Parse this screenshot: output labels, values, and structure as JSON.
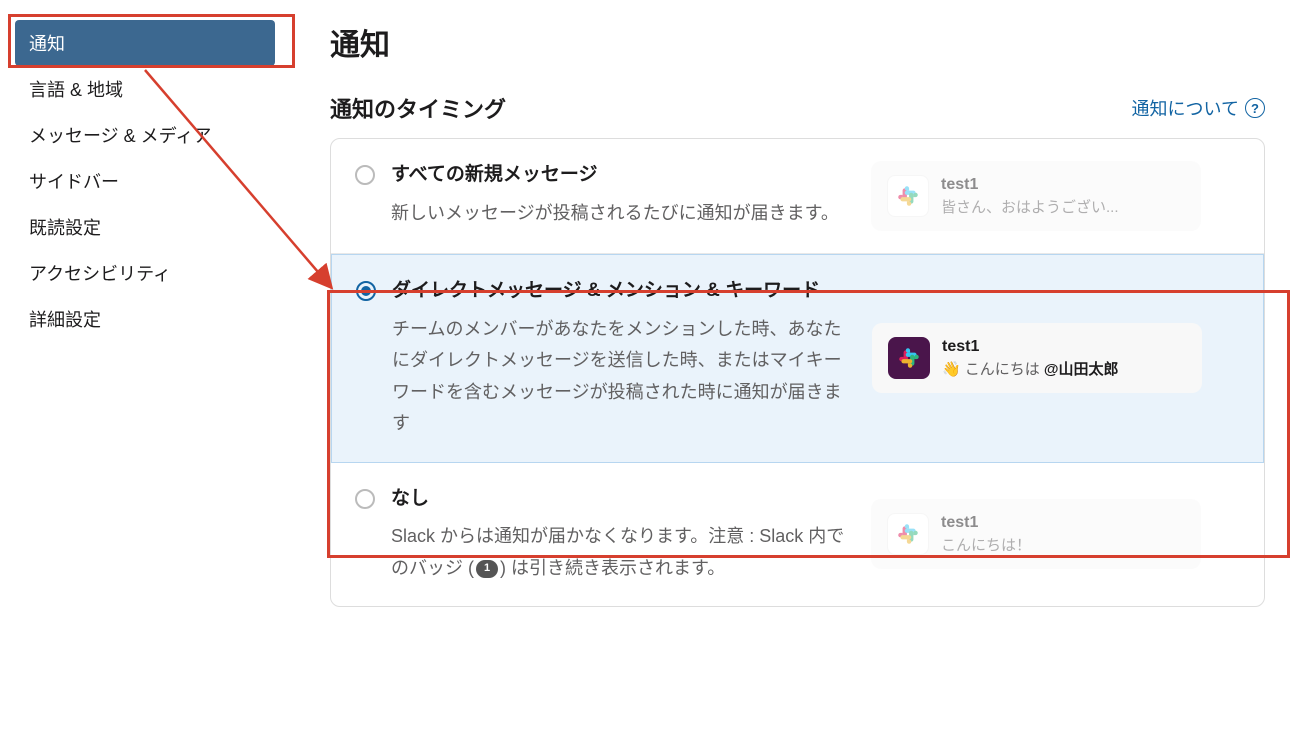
{
  "sidebar": {
    "items": [
      {
        "label": "通知",
        "active": true
      },
      {
        "label": "言語 & 地域",
        "active": false
      },
      {
        "label": "メッセージ & メディア",
        "active": false
      },
      {
        "label": "サイドバー",
        "active": false
      },
      {
        "label": "既読設定",
        "active": false
      },
      {
        "label": "アクセシビリティ",
        "active": false
      },
      {
        "label": "詳細設定",
        "active": false
      }
    ]
  },
  "page": {
    "title": "通知"
  },
  "section": {
    "title": "通知のタイミング",
    "help_label": "通知について",
    "help_icon_text": "?"
  },
  "options": [
    {
      "title": "すべての新規メッセージ",
      "desc": "新しいメッセージが投稿されるたびに通知が届きます。",
      "selected": false,
      "preview": {
        "sender": "test1",
        "message": "皆さん、おはようござい...",
        "faded": true,
        "icon": "light"
      }
    },
    {
      "title": "ダイレクトメッセージ & メンション & キーワード",
      "desc": "チームのメンバーがあなたをメンションした時、あなたにダイレクトメッセージを送信した時、またはマイキーワードを含むメッセージが投稿された時に通知が届きます",
      "selected": true,
      "preview": {
        "sender": "test1",
        "wave": "👋",
        "greeting": "こんにちは ",
        "mention": "@山田太郎",
        "faded": false,
        "icon": "dark"
      }
    },
    {
      "title": "なし",
      "desc_pre": "Slack からは通知が届かなくなります。注意 : Slack 内でのバッジ (",
      "badge": "1",
      "desc_post": ") は引き続き表示されます。",
      "selected": false,
      "preview": {
        "sender": "test1",
        "message": "こんにちは！",
        "faded": true,
        "icon": "light"
      }
    }
  ]
}
